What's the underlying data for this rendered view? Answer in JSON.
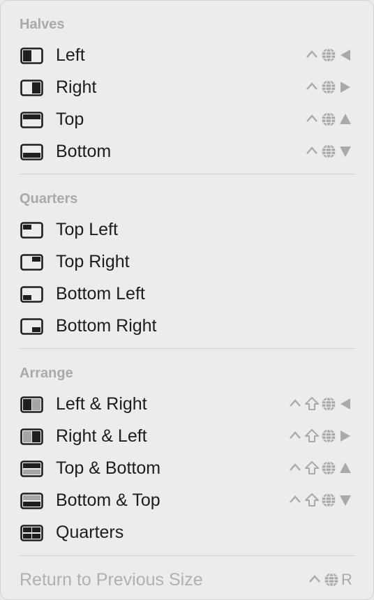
{
  "sections": [
    {
      "title": "Halves",
      "items": [
        {
          "label": "Left",
          "icon": "half-left-icon",
          "shortcut": [
            "ctrl",
            "globe",
            "left"
          ]
        },
        {
          "label": "Right",
          "icon": "half-right-icon",
          "shortcut": [
            "ctrl",
            "globe",
            "right"
          ]
        },
        {
          "label": "Top",
          "icon": "half-top-icon",
          "shortcut": [
            "ctrl",
            "globe",
            "up"
          ]
        },
        {
          "label": "Bottom",
          "icon": "half-bottom-icon",
          "shortcut": [
            "ctrl",
            "globe",
            "down"
          ]
        }
      ]
    },
    {
      "title": "Quarters",
      "items": [
        {
          "label": "Top Left",
          "icon": "quarter-top-left-icon"
        },
        {
          "label": "Top Right",
          "icon": "quarter-top-right-icon"
        },
        {
          "label": "Bottom Left",
          "icon": "quarter-bottom-left-icon"
        },
        {
          "label": "Bottom Right",
          "icon": "quarter-bottom-right-icon"
        }
      ]
    },
    {
      "title": "Arrange",
      "items": [
        {
          "label": "Left & Right",
          "icon": "arrange-left-right-icon",
          "shortcut": [
            "ctrl",
            "shift",
            "globe",
            "left"
          ]
        },
        {
          "label": "Right & Left",
          "icon": "arrange-right-left-icon",
          "shortcut": [
            "ctrl",
            "shift",
            "globe",
            "right"
          ]
        },
        {
          "label": "Top & Bottom",
          "icon": "arrange-top-bottom-icon",
          "shortcut": [
            "ctrl",
            "shift",
            "globe",
            "up"
          ]
        },
        {
          "label": "Bottom & Top",
          "icon": "arrange-bottom-top-icon",
          "shortcut": [
            "ctrl",
            "shift",
            "globe",
            "down"
          ]
        },
        {
          "label": "Quarters",
          "icon": "arrange-quarters-icon"
        }
      ]
    }
  ],
  "return_item": {
    "label": "Return to Previous Size",
    "shortcut_key": "R",
    "disabled": true
  },
  "colors": {
    "background": "#ececec",
    "text": "#1d1d1d",
    "muted": "#a9a9a9",
    "icon": "#1f1f1f",
    "separator": "#cfcfcf"
  }
}
